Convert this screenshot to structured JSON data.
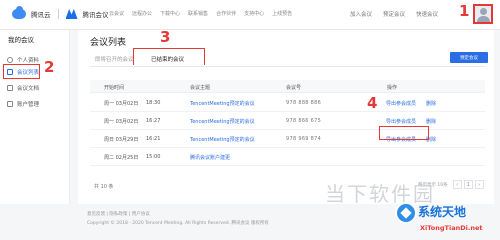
{
  "nav": {
    "brand_cloud": "腾讯云",
    "brand_meeting": "腾讯会议",
    "links": [
      "云会议",
      "远程办公",
      "下载中心",
      "联系销售",
      "合作伙伴",
      "支持中心",
      "上线预告"
    ],
    "right": [
      "加入会议",
      "预定会议",
      "快速会议"
    ]
  },
  "sidebar": {
    "title": "我的会议",
    "items": [
      "个人资料",
      "会议列表",
      "会议文档",
      "账户管理"
    ]
  },
  "main": {
    "title": "会议列表",
    "tabs": [
      "即将召开的会议",
      "已结束的会议"
    ],
    "schedule_button": "预定会议",
    "columns": [
      "开始时间",
      "会议主题",
      "会议号",
      "操作"
    ],
    "rows": [
      {
        "date": "周一 03月02日",
        "time": "18:30",
        "topic": "TencentMeeting预定的会议",
        "id": "978 888 886",
        "export": "导出参会成员",
        "delete": "删除"
      },
      {
        "date": "周一 03月02日",
        "time": "16:27",
        "topic": "TencentMeeting预定的会议",
        "id": "978 866 675",
        "export": "导出参会成员",
        "delete": "删除"
      },
      {
        "date": "周日 03月29日",
        "time": "16:21",
        "topic": "TencentMeeting预定的会议",
        "id": "978 969 874",
        "export": "导出参会成员",
        "delete": "删除"
      },
      {
        "date": "周二 02月25日",
        "time": "15:00",
        "topic": "腾讯会议账户建更",
        "id": "",
        "export": "",
        "delete": ""
      }
    ],
    "total": "共 10 条",
    "pager_info": "每页显示 10条",
    "page": "1"
  },
  "footer": {
    "links": "意见反馈 | 隐私政策 | 用户协议",
    "copyright": "Copyright © 2018 - 2020 Tencent Meeting. All Rights Reserved. 腾讯会议 版权所有"
  },
  "annotations": [
    "1",
    "2",
    "3",
    "4"
  ],
  "watermark": {
    "site_name": "系统天地",
    "url": "XiTongTianDi.net",
    "faint": "当下软件园"
  }
}
